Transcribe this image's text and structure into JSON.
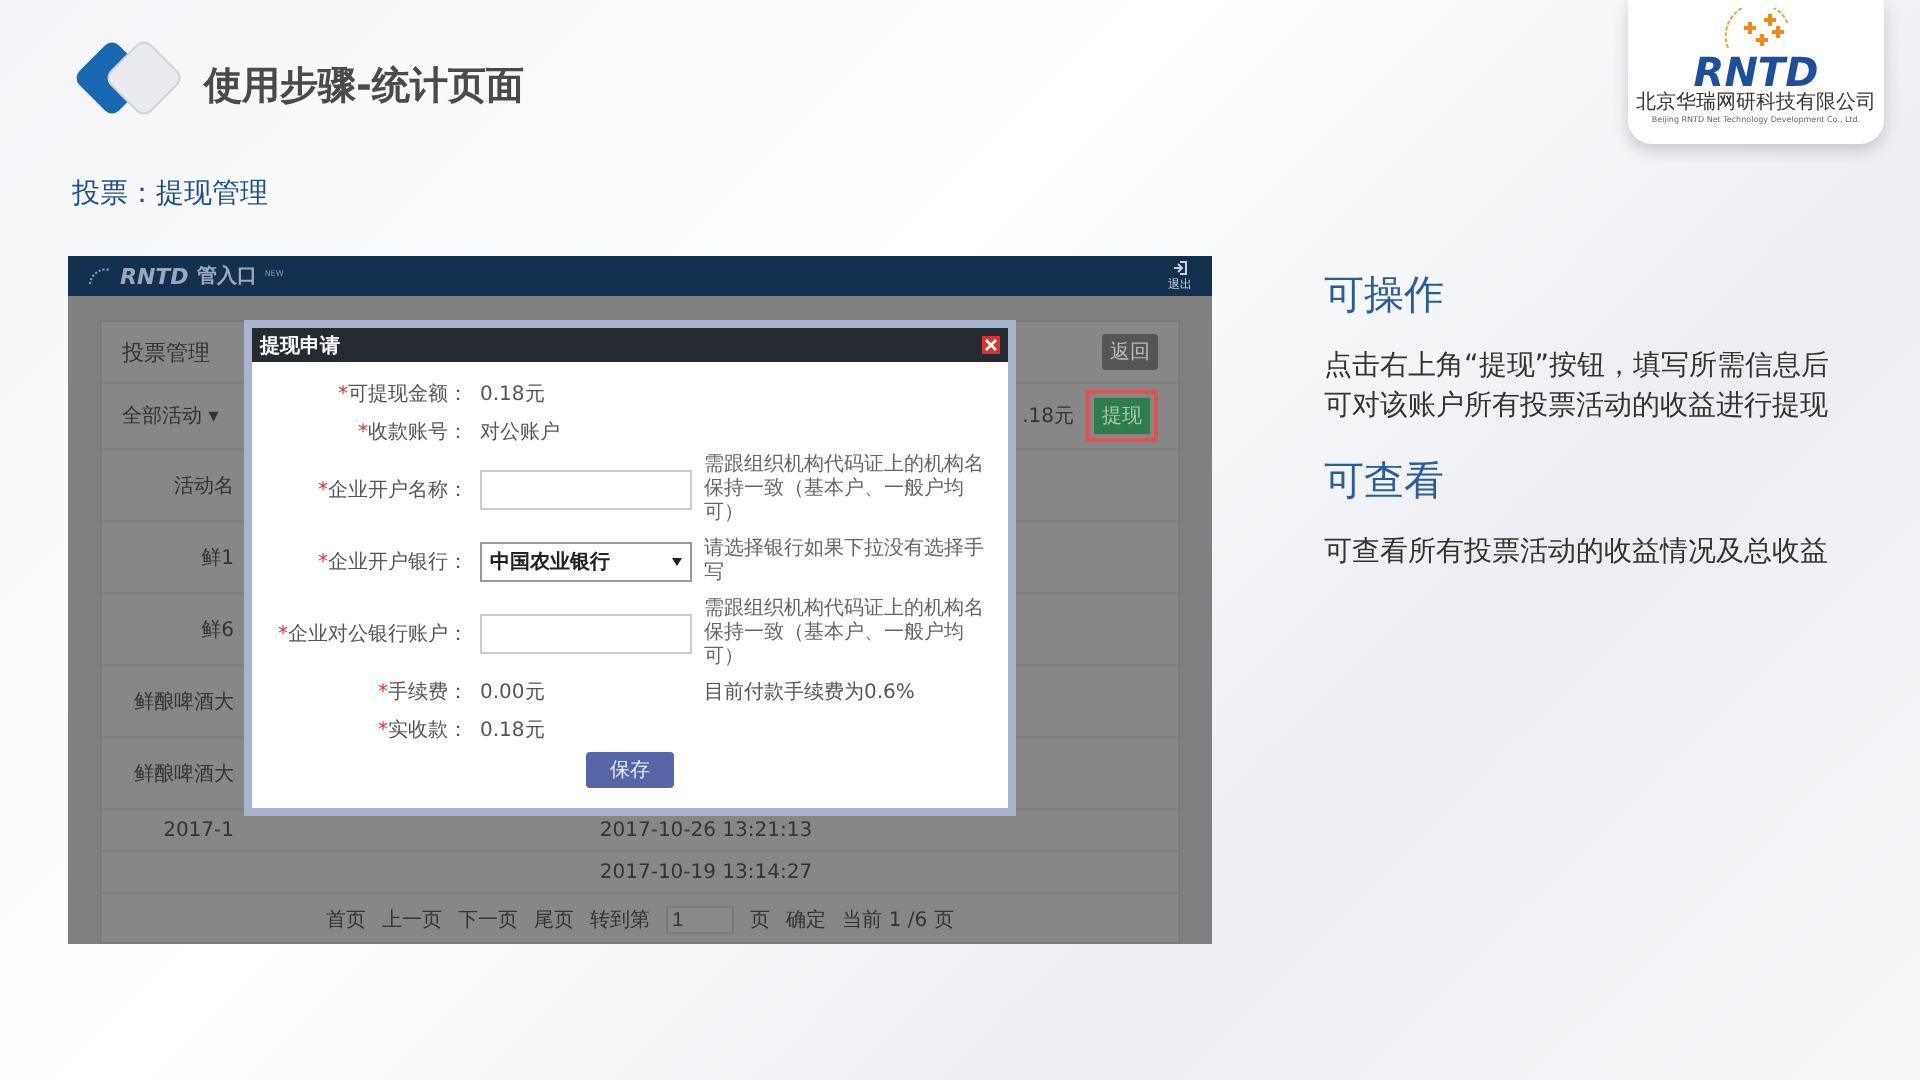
{
  "slide": {
    "title": "使用步骤-统计页面",
    "subtitle": "投票：提现管理"
  },
  "logo": {
    "brand": "RNTD",
    "company": "北京华瑞网研科技有限公司",
    "company_en": "Beijing RNTD Net Technology Development Co., Ltd."
  },
  "app": {
    "header": {
      "brand": "RNTD",
      "product": "管入口",
      "badge": "NEW",
      "logout": "退出"
    },
    "page_title": "投票管理",
    "back_button": "返回",
    "filter": {
      "label": "全部活动",
      "caret": "▾"
    },
    "balance": ".18元",
    "withdraw_button": {
      "label": "提现",
      "highlighted": true
    },
    "rows": [
      {
        "column_1": "活动名"
      },
      {
        "column_1": "鲜1"
      },
      {
        "column_1": "鲜6"
      },
      {
        "column_1": "鲜酿啤酒大"
      },
      {
        "column_1": "鲜酿啤酒大"
      },
      {
        "column_1": "2017-1",
        "column_2": "2017-10-26 13:21:13"
      },
      {
        "column_2": "2017-10-19 13:14:27"
      }
    ],
    "pagination": {
      "first": "首页",
      "prev": "上一页",
      "next": "下一页",
      "last": "尾页",
      "goto": "转到第",
      "page_input": "1",
      "page_unit": "页",
      "confirm": "确定",
      "current": "当前 1 /6 页"
    }
  },
  "dialog": {
    "title": "提现申请",
    "info": [
      {
        "mark": "*",
        "label": "可提现金额：",
        "value": "0.18元"
      },
      {
        "mark": "*",
        "label": "收款账号：",
        "value": "对公账户"
      }
    ],
    "fields": [
      {
        "kind": "input",
        "mark": "*",
        "label": "企业开户名称：",
        "hint": "需跟组织机构代码证上的机构名保持一致（基本户、一般户均可）"
      },
      {
        "kind": "select",
        "mark": "*",
        "label": "企业开户银行：",
        "value": "中国农业银行",
        "hint": "请选择银行如果下拉没有选择手写"
      },
      {
        "kind": "input",
        "mark": "*",
        "label": "企业对公银行账户：",
        "hint": "需跟组织机构代码证上的机构名保持一致（基本户、一般户均可）"
      }
    ],
    "fee": {
      "mark": "*",
      "label": "手续费：",
      "value": "0.00元",
      "note": "目前付款手续费为0.6%"
    },
    "received": {
      "mark": "*",
      "label": "实收款：",
      "value": "0.18元"
    },
    "save_button": "保存"
  },
  "notes": [
    {
      "heading": "可操作",
      "text": "点击右上角“提现”按钮，填写所需信息后可对该账户所有投票活动的收益进行提现"
    },
    {
      "heading": "可查看",
      "text": "可查看所有投票活动的收益情况及总收益"
    }
  ]
}
